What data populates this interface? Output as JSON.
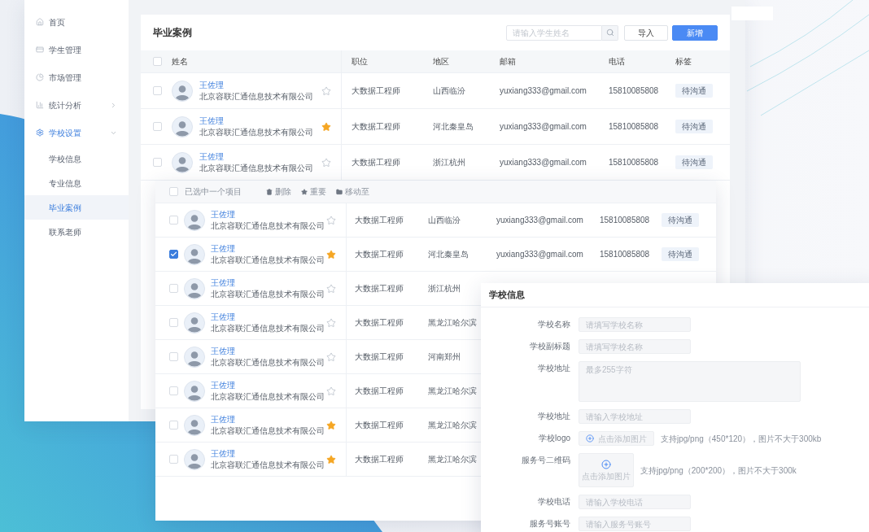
{
  "sidebar": {
    "items": [
      {
        "label": "首页",
        "selected": false
      },
      {
        "label": "学生管理",
        "selected": false
      },
      {
        "label": "市场管理",
        "selected": false
      },
      {
        "label": "统计分析",
        "selected": false,
        "expanded": false
      },
      {
        "label": "学校设置",
        "selected": true,
        "expanded": true,
        "children": [
          {
            "label": "学校信息",
            "selected": false
          },
          {
            "label": "专业信息",
            "selected": false
          },
          {
            "label": "毕业案例",
            "selected": true
          },
          {
            "label": "联系老师",
            "selected": false
          }
        ]
      }
    ]
  },
  "case_list": {
    "title": "毕业案例",
    "search": {
      "placeholder": "请输入学生姓名"
    },
    "buttons": [
      {
        "label": "导入",
        "kind": "default"
      },
      {
        "label": "新增",
        "kind": "primary"
      }
    ],
    "table": {
      "select_all": {
        "checked": false
      },
      "columns": [
        "姓名",
        "职位",
        "地区",
        "邮箱",
        "电话",
        "标签"
      ],
      "rows": [
        {
          "name": "王佐理",
          "company": "北京容联汇通信息技术有限公司",
          "checked": false,
          "starred": false,
          "position": "大数据工程师",
          "region": "山西临汾",
          "email": "yuxiang333@gmail.com",
          "phone": "15810085808",
          "tag": "待沟通"
        },
        {
          "name": "王佐理",
          "company": "北京容联汇通信息技术有限公司",
          "checked": false,
          "starred": true,
          "position": "大数据工程师",
          "region": "河北秦皇岛",
          "email": "yuxiang333@gmail.com",
          "phone": "15810085808",
          "tag": "待沟通"
        },
        {
          "name": "王佐理",
          "company": "北京容联汇通信息技术有限公司",
          "checked": false,
          "starred": false,
          "position": "大数据工程师",
          "region": "浙江杭州",
          "email": "yuxiang333@gmail.com",
          "phone": "15810085808",
          "tag": "待沟通"
        }
      ]
    }
  },
  "selection_panel": {
    "toolbar": {
      "select_all": {
        "checked": false
      },
      "status": "已选中一个项目",
      "actions": [
        {
          "label": "删除"
        },
        {
          "label": "重要"
        },
        {
          "label": "移动至"
        }
      ]
    },
    "rows": [
      {
        "name": "王佐理",
        "company": "北京容联汇通信息技术有限公司",
        "checked": false,
        "starred": false,
        "position": "大数据工程师",
        "region": "山西临汾",
        "email": "yuxiang333@gmail.com",
        "phone": "15810085808",
        "tag": "待沟通"
      },
      {
        "name": "王佐理",
        "company": "北京容联汇通信息技术有限公司",
        "checked": true,
        "starred": true,
        "position": "大数据工程师",
        "region": "河北秦皇岛",
        "email": "yuxiang333@gmail.com",
        "phone": "15810085808",
        "tag": "待沟通"
      },
      {
        "name": "王佐理",
        "company": "北京容联汇通信息技术有限公司",
        "checked": false,
        "starred": false,
        "position": "大数据工程师",
        "region": "浙江杭州"
      },
      {
        "name": "王佐理",
        "company": "北京容联汇通信息技术有限公司",
        "checked": false,
        "starred": false,
        "position": "大数据工程师",
        "region": "黑龙江哈尔滨"
      },
      {
        "name": "王佐理",
        "company": "北京容联汇通信息技术有限公司",
        "checked": false,
        "starred": false,
        "position": "大数据工程师",
        "region": "河南郑州"
      },
      {
        "name": "王佐理",
        "company": "北京容联汇通信息技术有限公司",
        "checked": false,
        "starred": false,
        "position": "大数据工程师",
        "region": "黑龙江哈尔滨"
      },
      {
        "name": "王佐理",
        "company": "北京容联汇通信息技术有限公司",
        "checked": false,
        "starred": true,
        "position": "大数据工程师",
        "region": "黑龙江哈尔滨"
      },
      {
        "name": "王佐理",
        "company": "北京容联汇通信息技术有限公司",
        "checked": false,
        "starred": true,
        "position": "大数据工程师",
        "region": "黑龙江哈尔滨"
      }
    ]
  },
  "school_info": {
    "title": "学校信息",
    "fields": [
      {
        "kind": "input",
        "label": "学校名称",
        "placeholder": "请填写学校名称"
      },
      {
        "kind": "input",
        "label": "学校副标题",
        "placeholder": "请填写学校名称"
      },
      {
        "kind": "textarea",
        "label": "学校地址",
        "placeholder": "最多255字符"
      },
      {
        "kind": "input",
        "label": "学校地址",
        "placeholder": "请输入学校地址"
      },
      {
        "kind": "upload_button",
        "label": "学校logo",
        "button": "点击添加图片",
        "hint": "支持jpg/png（450*120），图片不大于300kb"
      },
      {
        "kind": "upload_box",
        "label": "服务号二维码",
        "button": "点击添加图片",
        "hint": "支持jpg/png（200*200），图片不大于300k"
      },
      {
        "kind": "input",
        "label": "学校电话",
        "placeholder": "请输入学校电话"
      },
      {
        "kind": "input",
        "label": "服务号账号",
        "placeholder": "请输入服务号账号"
      }
    ]
  }
}
